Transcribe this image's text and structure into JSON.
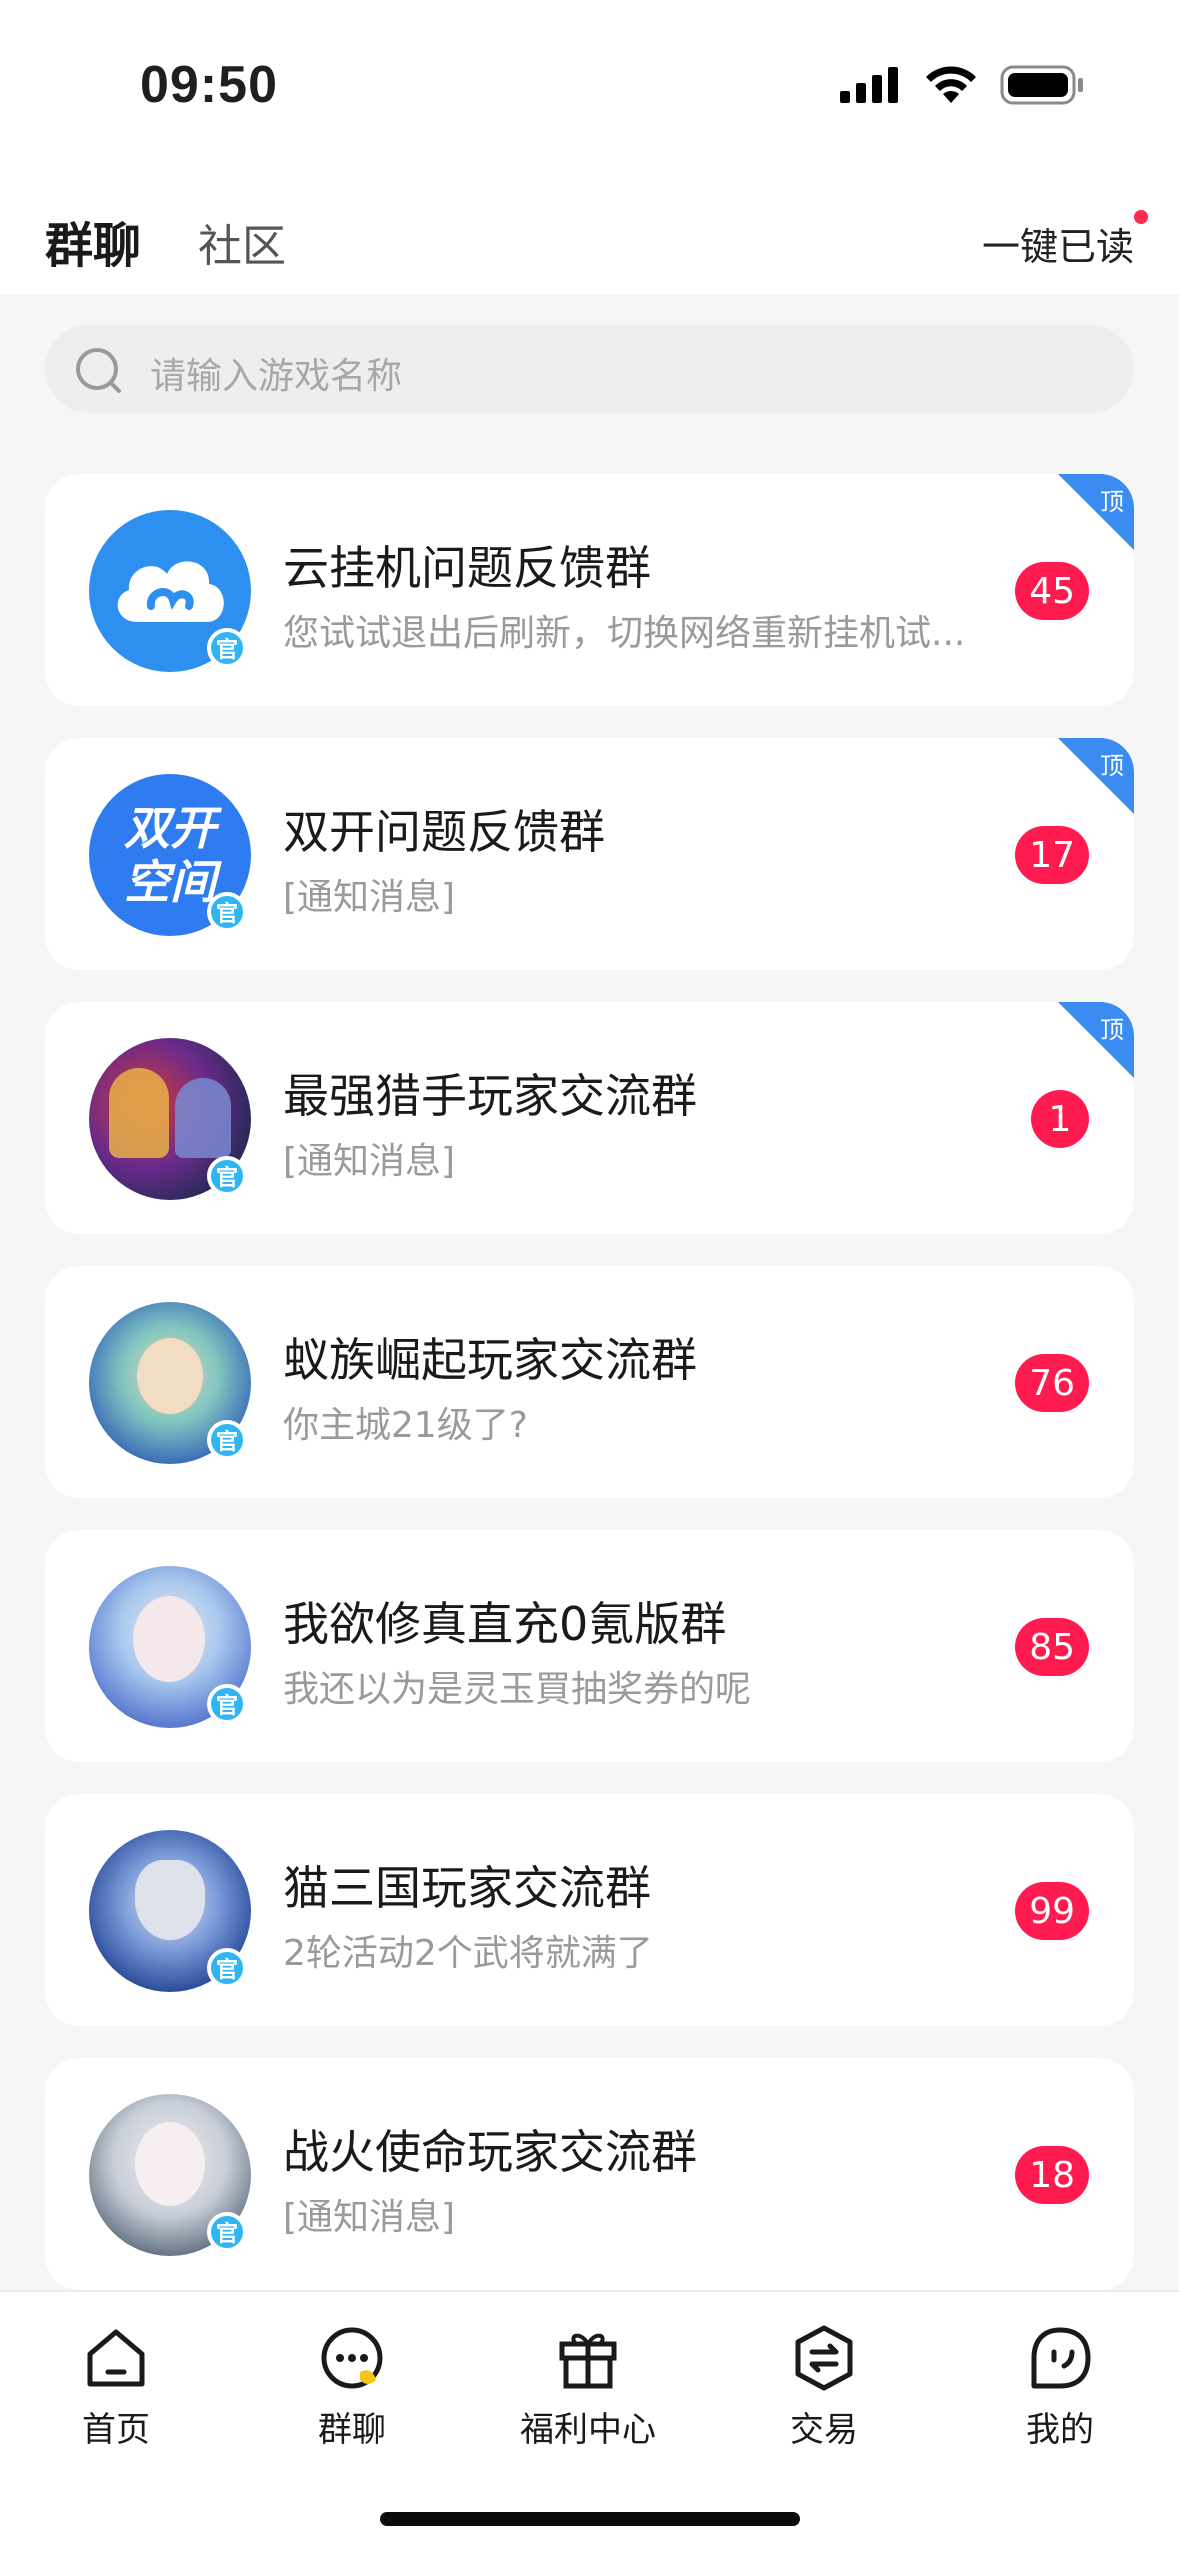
{
  "status_bar": {
    "time": "09:50"
  },
  "header": {
    "tabs": [
      {
        "label": "群聊",
        "active": true
      },
      {
        "label": "社区",
        "active": false
      }
    ],
    "mark_all_read": "一键已读"
  },
  "search": {
    "placeholder": "请输入游戏名称"
  },
  "official_badge": "官",
  "pin_label": "顶",
  "groups": [
    {
      "title": "云挂机问题反馈群",
      "preview": "您试试退出后刷新，切换网络重新挂机试...",
      "unread": "45",
      "pinned": true,
      "avatar": "cloud-logo-icon"
    },
    {
      "title": "双开问题反馈群",
      "preview": "[通知消息]",
      "unread": "17",
      "pinned": true,
      "avatar": "dual-space-logo",
      "avatar_text": "双开空间"
    },
    {
      "title": "最强猎手玩家交流群",
      "preview": "[通知消息]",
      "unread": "1",
      "pinned": true,
      "avatar": "game-art-avatar"
    },
    {
      "title": "蚁族崛起玩家交流群",
      "preview": "你主城21级了?",
      "unread": "76",
      "pinned": false,
      "avatar": "game-art-avatar"
    },
    {
      "title": "我欲修真直充0氪版群",
      "preview": "我还以为是灵玉買抽奖券的呢",
      "unread": "85",
      "pinned": false,
      "avatar": "game-art-avatar"
    },
    {
      "title": "猫三国玩家交流群",
      "preview": "2轮活动2个武将就满了",
      "unread": "99",
      "pinned": false,
      "avatar": "game-art-avatar"
    },
    {
      "title": "战火使命玩家交流群",
      "preview": "[通知消息]",
      "unread": "18",
      "pinned": false,
      "avatar": "game-art-avatar"
    }
  ],
  "tabbar": [
    {
      "label": "首页",
      "icon": "home-icon"
    },
    {
      "label": "群聊",
      "icon": "chat-icon"
    },
    {
      "label": "福利中心",
      "icon": "gift-icon"
    },
    {
      "label": "交易",
      "icon": "trade-icon"
    },
    {
      "label": "我的",
      "icon": "profile-icon"
    }
  ],
  "colors": {
    "accent_red": "#ff1a4f",
    "pin_blue": "#3a8cf0",
    "official_blue": "#2fb6f2"
  }
}
